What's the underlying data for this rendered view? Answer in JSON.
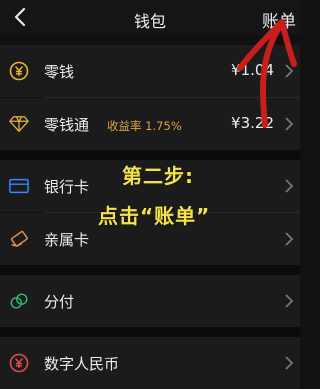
{
  "navbar": {
    "title": "钱包",
    "action_label": "账单",
    "back_icon": "chevron-left-icon"
  },
  "items": [
    {
      "label": "零钱",
      "amount": "¥1.04",
      "icon": "yuan-coin-icon",
      "icon_color": "#e3b53c"
    },
    {
      "label": "零钱通",
      "subtitle": "收益率 1.75%",
      "amount": "¥3.22",
      "icon": "diamond-icon",
      "icon_color": "#e3b53c"
    },
    {
      "label": "银行卡",
      "icon": "card-icon",
      "icon_color": "#3a86ff"
    },
    {
      "label": "亲属卡",
      "icon": "card-tilted-icon",
      "icon_color": "#e8904a"
    },
    {
      "label": "分付",
      "icon": "linked-rings-icon",
      "icon_color": "#2fb86a"
    },
    {
      "label": "数字人民币",
      "icon": "yuan-circle-icon",
      "icon_color": "#e14b4b"
    }
  ],
  "annotation": {
    "line1": "第二步:",
    "line2": "点击“账单”",
    "color": "#f4e44a",
    "arrow_color": "#c81e1e"
  }
}
